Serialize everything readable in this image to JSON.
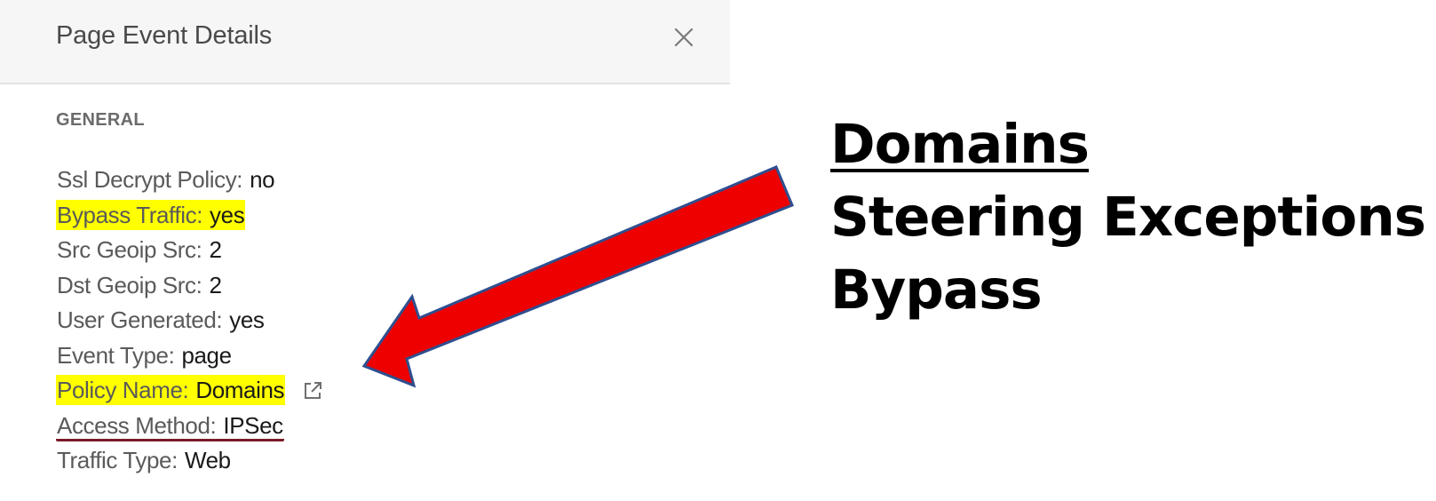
{
  "panel": {
    "title": "Page Event Details",
    "close_icon": "close-icon",
    "section_title": "GENERAL",
    "fields": [
      {
        "label": "Ssl Decrypt Policy:",
        "value": "no"
      },
      {
        "label": "Bypass Traffic:",
        "value": "yes",
        "highlight": "#ffff00"
      },
      {
        "label": "Src Geoip Src:",
        "value": "2"
      },
      {
        "label": "Dst Geoip Src:",
        "value": "2"
      },
      {
        "label": "User Generated:",
        "value": "yes"
      },
      {
        "label": "Event Type:",
        "value": "page"
      },
      {
        "label": "Policy Name:",
        "value": "Domains",
        "highlight": "#ffff00",
        "icon": "external-link-icon"
      },
      {
        "label": "Access Method:",
        "value": "IPSec",
        "underline": "#7b1a2a"
      },
      {
        "label": "Traffic Type:",
        "value": "Web"
      }
    ]
  },
  "annotation": {
    "lines": [
      "Domains",
      "Steering Exceptions",
      "Bypass"
    ],
    "arrow_icon": "red-arrow-icon",
    "arrow_color": "#ee0000",
    "arrow_outline": "#2f4f8f"
  }
}
